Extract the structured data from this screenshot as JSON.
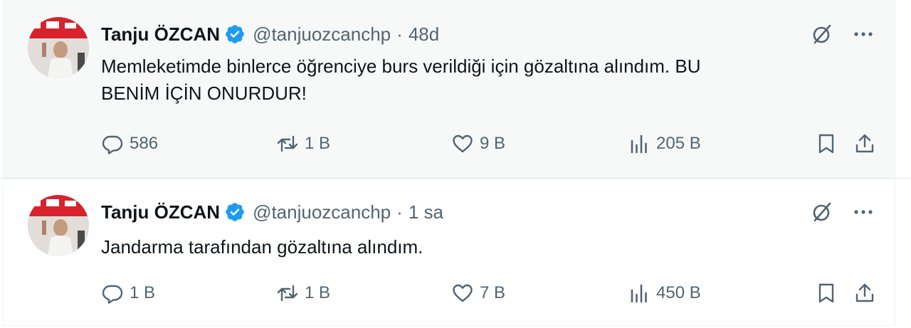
{
  "tweets": [
    {
      "author_name": "Tanju ÖZCAN",
      "handle": "@tanjuozcanchp",
      "separator": "·",
      "time": "48d",
      "text_line1": "Memleketimde binlerce öğrenciye burs verildiği için gözaltına alındım. BU",
      "text_line2": "BENİM İÇİN ONURDUR!",
      "replies": "586",
      "reposts": "1 B",
      "likes": "9 B",
      "views": "205 B"
    },
    {
      "author_name": "Tanju ÖZCAN",
      "handle": "@tanjuozcanchp",
      "separator": "·",
      "time": "1 sa",
      "text_line1": "Jandarma tarafından gözaltına alındım.",
      "replies": "1 B",
      "reposts": "1 B",
      "likes": "7 B",
      "views": "450 B"
    }
  ],
  "icons": {
    "verified": "verified-badge-icon",
    "grok": "grok-icon",
    "more": "more-icon",
    "reply": "reply-icon",
    "repost": "repost-icon",
    "like": "like-icon",
    "views": "views-icon",
    "bookmark": "bookmark-icon",
    "share": "share-icon"
  },
  "colors": {
    "verified": "#1d9bf0",
    "text": "#0f1419",
    "secondary": "#536471"
  }
}
